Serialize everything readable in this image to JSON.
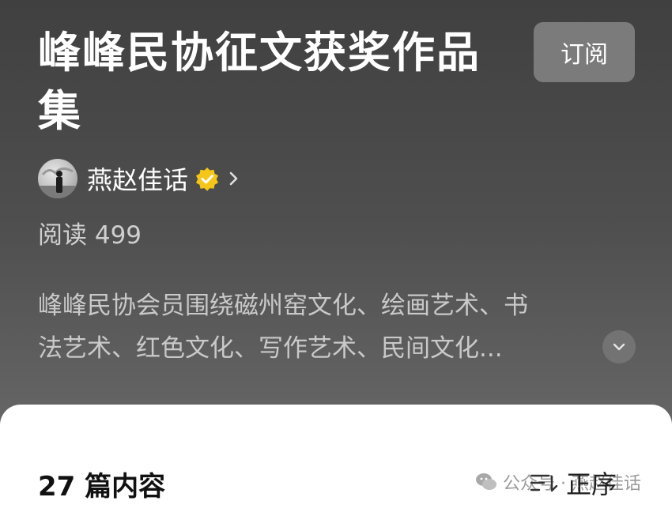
{
  "collection": {
    "title": "峰峰民协征文获奖作品集",
    "subscribe_label": "订阅"
  },
  "author": {
    "name": "燕赵佳话",
    "verified": true
  },
  "stats": {
    "reads_label": "阅读 499"
  },
  "description": {
    "line1": "峰峰民协会员围绕磁州窑文化、绘画艺术、书",
    "line2": "法艺术、红色文化、写作艺术、民间文化..."
  },
  "content": {
    "count_label": "27 篇内容",
    "sort_label": "正序"
  },
  "watermark": {
    "text": "公众号 · 燕赵佳话"
  },
  "colors": {
    "verified_badge": "#f5c518",
    "subscribe_bg": "#7b7b7b",
    "sheet_bg": "#ffffff"
  },
  "icons": [
    "verified-badge-icon",
    "chevron-right-icon",
    "chevron-down-icon",
    "sort-icon",
    "wechat-logo-icon"
  ]
}
